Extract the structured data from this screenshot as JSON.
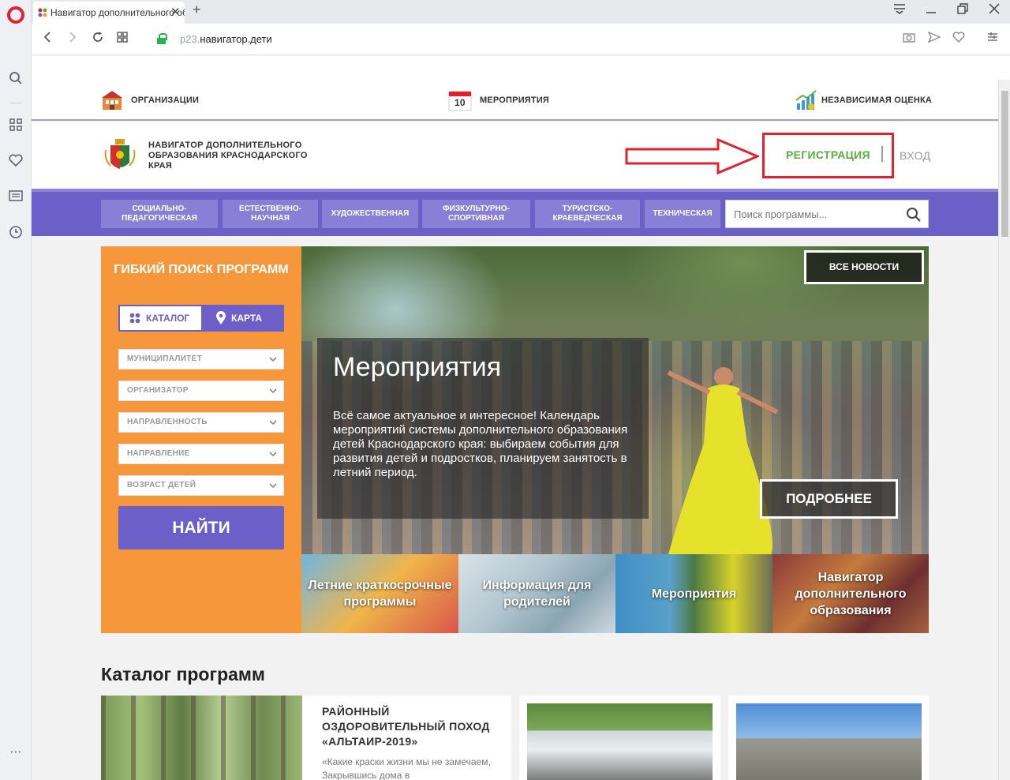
{
  "browser": {
    "tab_title": "Навигатор дополнительного образования",
    "url_sub": "р23.",
    "url_main": "навигатор.дети"
  },
  "top_nav": {
    "organizations": "ОРГАНИЗАЦИИ",
    "calendar_day": "10",
    "events": "МЕРОПРИЯТИЯ",
    "evaluation": "НЕЗАВИСИМАЯ ОЦЕНКА"
  },
  "header": {
    "brand": "НАВИГАТОР ДОПОЛНИТЕЛЬНОГО ОБРАЗОВАНИЯ КРАСНОДАРСКОГО КРАЯ",
    "register": "РЕГИСТРАЦИЯ",
    "login": "ВХОД"
  },
  "categories": [
    "СОЦИАЛЬНО-ПЕДАГОГИЧЕСКАЯ",
    "ЕСТЕСТВЕННО-НАУЧНАЯ",
    "ХУДОЖЕСТВЕННАЯ",
    "ФИЗКУЛЬТУРНО-СПОРТИВНАЯ",
    "ТУРИСТСКО-КРАЕВЕДЧЕСКАЯ",
    "ТЕХНИЧЕСКАЯ"
  ],
  "search": {
    "placeholder": "Поиск программы..."
  },
  "flex_search": {
    "title": "ГИБКИЙ ПОИСК ПРОГРАММ",
    "catalog": "КАТАЛОГ",
    "map": "КАРТА",
    "filters": [
      "МУНИЦИПАЛИТЕТ",
      "ОРГАНИЗАТОР",
      "НАПРАВЛЕННОСТЬ",
      "НАПРАВЛЕНИЕ",
      "ВОЗРАСТ ДЕТЕЙ"
    ],
    "find": "НАЙТИ"
  },
  "hero": {
    "all_news": "ВСЕ НОВОСТИ",
    "title": "Мероприятия",
    "text": "Всё самое актуальное и интересное! Календарь мероприятий системы дополнительного образования детей Краснодарского края: выбираем события для развития детей и подростков, планируем занятость в летний период.",
    "more": "ПОДРОБНЕЕ"
  },
  "tiles": [
    "Летние краткосрочные программы",
    "Информация для родителей",
    "Мероприятия",
    "Навигатор дополнительного образования"
  ],
  "catalog": {
    "title": "Каталог программ",
    "card1_title": "РАЙОННЫЙ ОЗДОРОВИТЕЛЬНЫЙ ПОХОД «АЛЬТАИР-2019»",
    "card1_text": "«Какие краски жизни мы не замечаем, Закрывшись дома в"
  },
  "colors": {
    "purple": "#6c5fc7",
    "orange": "#f5973a",
    "register_green": "#5cad3f",
    "highlight_red": "#e3202d"
  }
}
